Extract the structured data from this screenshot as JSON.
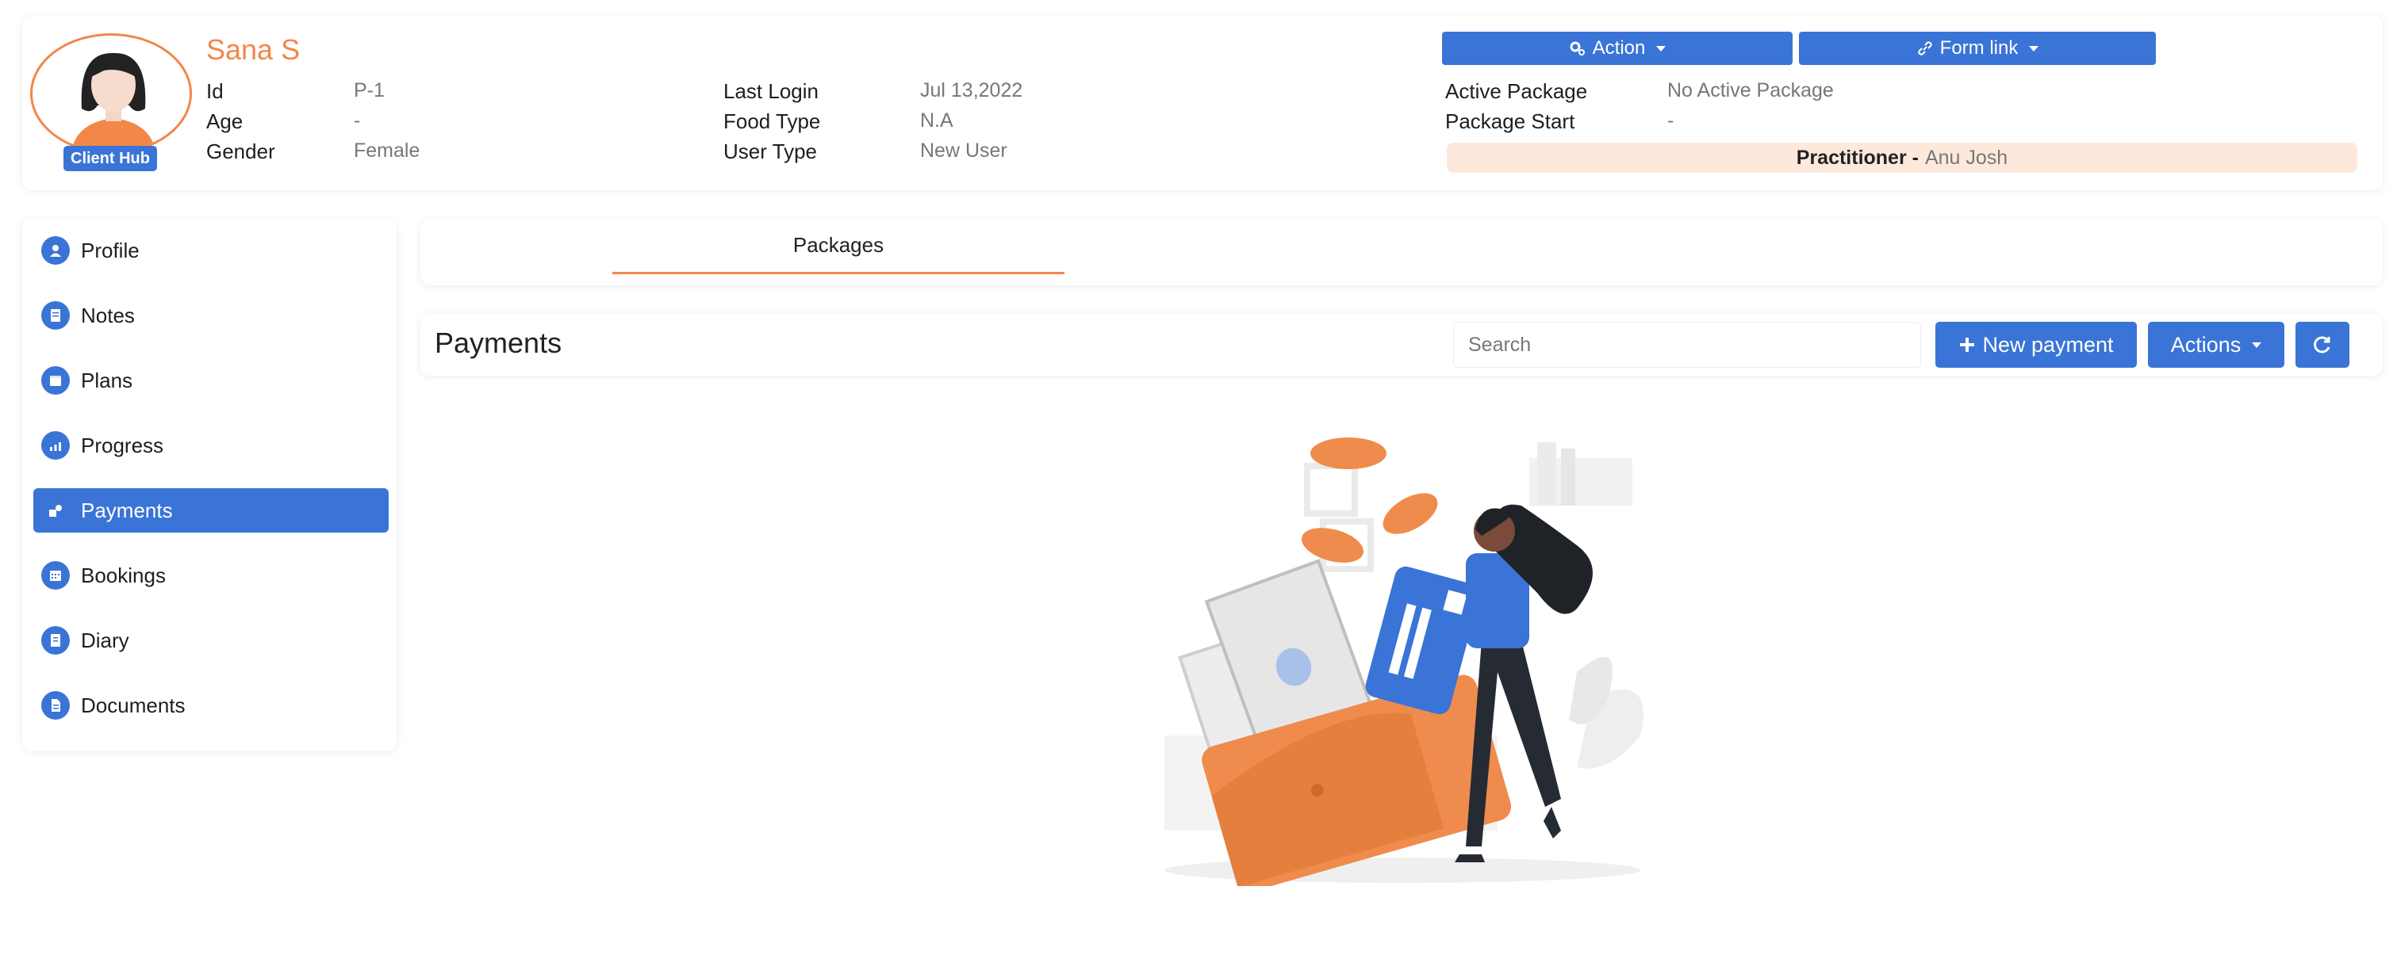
{
  "client": {
    "name": "Sana S",
    "badge": "Client Hub",
    "fields_left": [
      {
        "label": "Id",
        "value": "P-1"
      },
      {
        "label": "Age",
        "value": "-"
      },
      {
        "label": "Gender",
        "value": "Female"
      }
    ],
    "fields_mid": [
      {
        "label": "Last Login",
        "value": "Jul 13,2022"
      },
      {
        "label": "Food Type",
        "value": "N.A"
      },
      {
        "label": "User Type",
        "value": "New User"
      }
    ],
    "fields_right": [
      {
        "label": "Active Package",
        "value": "No Active Package"
      },
      {
        "label": "Package Start",
        "value": "-"
      }
    ],
    "practitioner_label": "Practitioner -",
    "practitioner_name": "Anu Josh"
  },
  "header_buttons": {
    "action": "Action",
    "form_link": "Form link"
  },
  "sidebar": {
    "items": [
      {
        "label": "Profile",
        "icon": "user-icon"
      },
      {
        "label": "Notes",
        "icon": "notes-icon"
      },
      {
        "label": "Plans",
        "icon": "plans-icon"
      },
      {
        "label": "Progress",
        "icon": "chart-icon"
      },
      {
        "label": "Payments",
        "icon": "payment-icon"
      },
      {
        "label": "Bookings",
        "icon": "calendar-icon"
      },
      {
        "label": "Diary",
        "icon": "diary-icon"
      },
      {
        "label": "Documents",
        "icon": "document-icon"
      }
    ],
    "active": "Payments"
  },
  "tabs": [
    {
      "label": "Packages"
    }
  ],
  "payments": {
    "title": "Payments",
    "search_placeholder": "Search",
    "new_payment": "New payment",
    "actions": "Actions"
  },
  "colors": {
    "primary": "#3a74d6",
    "accent": "#f2874a",
    "practitioner_bg": "#fde9dc"
  }
}
